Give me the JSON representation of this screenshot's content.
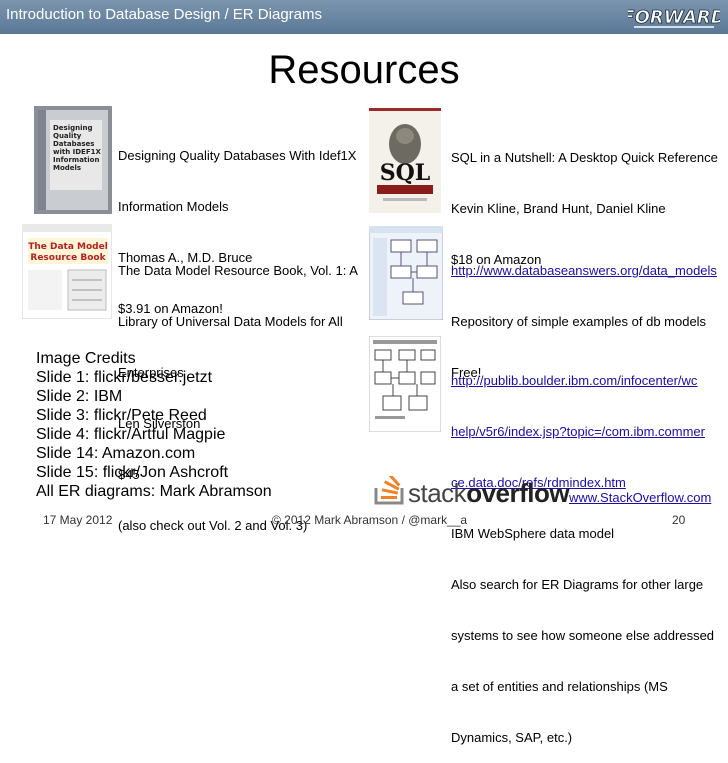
{
  "header": {
    "title": "Introduction to Database Design / ER Diagrams",
    "logo_text": "FORWARD"
  },
  "slide_title": "Resources",
  "book1": [
    "Designing Quality Databases With Idef1X",
    "Information Models",
    "Thomas A., M.D. Bruce",
    "$3.91 on Amazon!"
  ],
  "book1_cover": [
    "Designing",
    "Quality",
    "Databases",
    "with IDEF1X",
    "Information",
    "Models"
  ],
  "book2": [
    "SQL in a Nutshell: A Desktop Quick Reference",
    "Kevin Kline, Brand Hunt, Daniel Kline",
    "$18 on Amazon"
  ],
  "book2_cover": "SQL",
  "book3": [
    "The Data Model Resource Book, Vol. 1: A",
    "Library of Universal Data Models for All",
    "Enterprises",
    "Len Silverston",
    "$45",
    "(also check out Vol. 2 and Vol. 3)"
  ],
  "book3_cover": "The Data Model Resource Book",
  "site1": {
    "link": "http://www.databaseanswers.org/data_models",
    "lines": [
      "Repository of simple examples of db models",
      "Free!"
    ]
  },
  "site2": {
    "link_lines": [
      "http://publib.boulder.ibm.com/infocenter/wc",
      "help/v5r6/index.jsp?topic=/com.ibm.commer",
      "ce.data.doc/refs/rdmindex.htm"
    ],
    "lines": [
      "IBM WebSphere data model",
      "Also search for ER Diagrams for other large",
      "systems to see how someone else addressed",
      "a set of entities and relationships (MS",
      "Dynamics, SAP, etc.)"
    ]
  },
  "credits": [
    "Image Credits",
    "Slide 1: flickr/besser.jetzt",
    "Slide 2: IBM",
    "Slide 3: flickr/Pete Reed",
    "Slide 4: flickr/Artful Magpie",
    "Slide 14: Amazon.com",
    "Slide 15: flickr/Jon Ashcroft",
    "All ER diagrams: Mark Abramson"
  ],
  "stackoverflow": {
    "logo_a": "stack",
    "logo_b": "overflow",
    "link": "www.StackOverflow.com"
  },
  "footer": {
    "date": "17 May 2012",
    "copyright": "© 2012 Mark Abramson / @mark__a",
    "page": "20"
  },
  "colors": {
    "header_bg": "#6a86a2",
    "link": "#1a0dab",
    "so_orange": "#f48024"
  }
}
